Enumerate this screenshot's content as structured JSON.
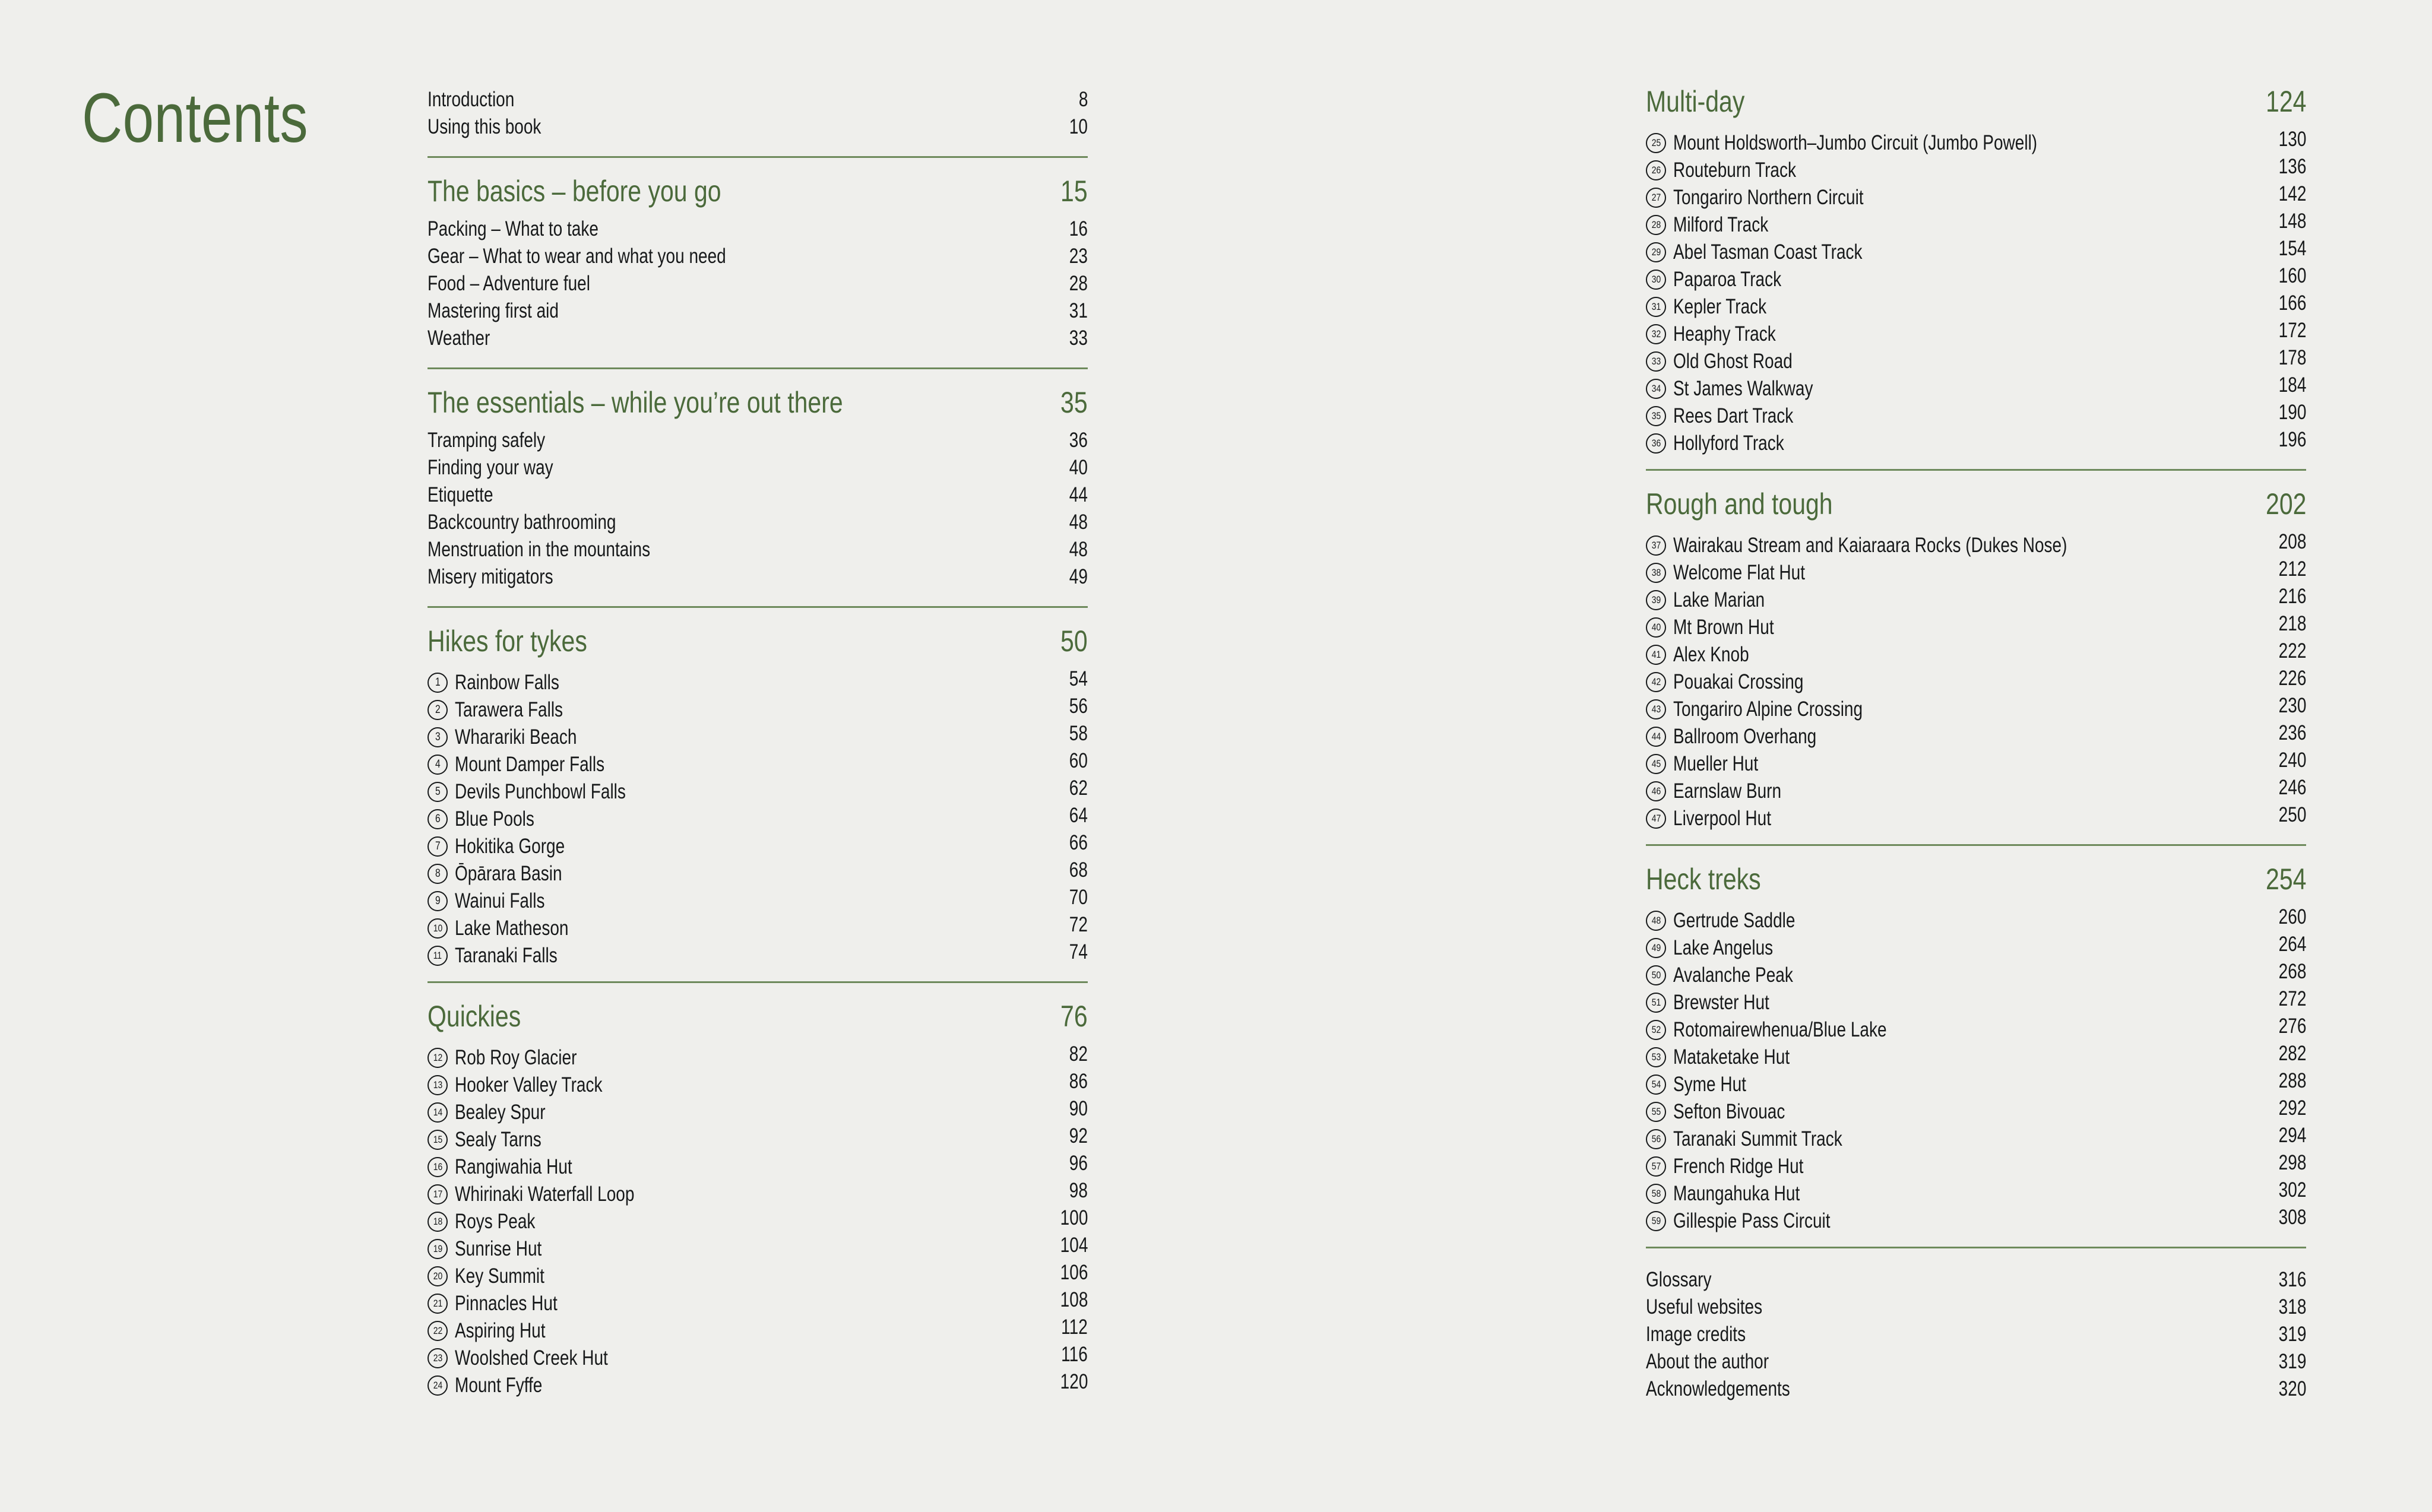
{
  "page_title": "Contents",
  "colors": {
    "background": "#efefec",
    "accent_green": "#4b6a3b",
    "rule_green": "#6e8a5c",
    "text": "#17191a"
  },
  "left_column": [
    {
      "type": "plain_block",
      "entries": [
        {
          "label": "Introduction",
          "page": "8"
        },
        {
          "label": "Using this book",
          "page": "10"
        }
      ]
    },
    {
      "type": "section",
      "heading": {
        "label": "The basics – before you go",
        "page": "15"
      },
      "entries": [
        {
          "label": "Packing – What to take",
          "page": "16"
        },
        {
          "label": "Gear – What to wear and what you need",
          "page": "23"
        },
        {
          "label": "Food – Adventure fuel",
          "page": "28"
        },
        {
          "label": "Mastering first aid",
          "page": "31"
        },
        {
          "label": "Weather",
          "page": "33"
        }
      ]
    },
    {
      "type": "section",
      "heading": {
        "label": "The essentials – while you’re out there",
        "page": "35"
      },
      "entries": [
        {
          "label": "Tramping safely",
          "page": "36"
        },
        {
          "label": "Finding your way",
          "page": "40"
        },
        {
          "label": "Etiquette",
          "page": "44"
        },
        {
          "label": "Backcountry bathrooming",
          "page": "48"
        },
        {
          "label": "Menstruation in the mountains",
          "page": "48"
        },
        {
          "label": "Misery mitigators",
          "page": "49"
        }
      ]
    },
    {
      "type": "section",
      "heading": {
        "label": "Hikes for tykes",
        "page": "50"
      },
      "entries": [
        {
          "num": "1",
          "label": "Rainbow Falls",
          "page": "54"
        },
        {
          "num": "2",
          "label": "Tarawera Falls",
          "page": "56"
        },
        {
          "num": "3",
          "label": "Wharariki Beach",
          "page": "58"
        },
        {
          "num": "4",
          "label": "Mount Damper Falls",
          "page": "60"
        },
        {
          "num": "5",
          "label": "Devils Punchbowl Falls",
          "page": "62"
        },
        {
          "num": "6",
          "label": "Blue Pools",
          "page": "64"
        },
        {
          "num": "7",
          "label": "Hokitika Gorge",
          "page": "66"
        },
        {
          "num": "8",
          "label": "Ōpārara Basin",
          "page": "68"
        },
        {
          "num": "9",
          "label": "Wainui Falls",
          "page": "70"
        },
        {
          "num": "10",
          "label": "Lake Matheson",
          "page": "72"
        },
        {
          "num": "11",
          "label": "Taranaki Falls",
          "page": "74"
        }
      ]
    },
    {
      "type": "section",
      "heading": {
        "label": "Quickies",
        "page": "76"
      },
      "entries": [
        {
          "num": "12",
          "label": "Rob Roy Glacier",
          "page": "82"
        },
        {
          "num": "13",
          "label": "Hooker Valley Track",
          "page": "86"
        },
        {
          "num": "14",
          "label": "Bealey Spur",
          "page": "90"
        },
        {
          "num": "15",
          "label": "Sealy Tarns",
          "page": "92"
        },
        {
          "num": "16",
          "label": "Rangiwahia Hut",
          "page": "96"
        },
        {
          "num": "17",
          "label": "Whirinaki Waterfall Loop",
          "page": "98"
        },
        {
          "num": "18",
          "label": "Roys Peak",
          "page": "100"
        },
        {
          "num": "19",
          "label": "Sunrise Hut",
          "page": "104"
        },
        {
          "num": "20",
          "label": "Key Summit",
          "page": "106"
        },
        {
          "num": "21",
          "label": "Pinnacles Hut",
          "page": "108"
        },
        {
          "num": "22",
          "label": "Aspiring Hut",
          "page": "112"
        },
        {
          "num": "23",
          "label": "Woolshed Creek Hut",
          "page": "116"
        },
        {
          "num": "24",
          "label": "Mount Fyffe",
          "page": "120"
        }
      ]
    }
  ],
  "right_column": [
    {
      "type": "section",
      "heading": {
        "label": "Multi-day",
        "page": "124"
      },
      "entries": [
        {
          "num": "25",
          "label": "Mount Holdsworth–Jumbo Circuit (Jumbo Powell)",
          "page": "130"
        },
        {
          "num": "26",
          "label": "Routeburn Track",
          "page": "136"
        },
        {
          "num": "27",
          "label": "Tongariro Northern Circuit",
          "page": "142"
        },
        {
          "num": "28",
          "label": "Milford Track",
          "page": "148"
        },
        {
          "num": "29",
          "label": "Abel Tasman Coast Track",
          "page": "154"
        },
        {
          "num": "30",
          "label": "Paparoa Track",
          "page": "160"
        },
        {
          "num": "31",
          "label": "Kepler Track",
          "page": "166"
        },
        {
          "num": "32",
          "label": "Heaphy Track",
          "page": "172"
        },
        {
          "num": "33",
          "label": "Old Ghost Road",
          "page": "178"
        },
        {
          "num": "34",
          "label": "St James Walkway",
          "page": "184"
        },
        {
          "num": "35",
          "label": "Rees Dart Track",
          "page": "190"
        },
        {
          "num": "36",
          "label": "Hollyford Track",
          "page": "196"
        }
      ]
    },
    {
      "type": "section",
      "heading": {
        "label": "Rough and tough",
        "page": "202"
      },
      "entries": [
        {
          "num": "37",
          "label": "Wairakau Stream and Kaiaraara Rocks (Dukes Nose)",
          "page": "208"
        },
        {
          "num": "38",
          "label": "Welcome Flat Hut",
          "page": "212"
        },
        {
          "num": "39",
          "label": "Lake Marian",
          "page": "216"
        },
        {
          "num": "40",
          "label": "Mt Brown Hut",
          "page": "218"
        },
        {
          "num": "41",
          "label": "Alex Knob",
          "page": "222"
        },
        {
          "num": "42",
          "label": "Pouakai Crossing",
          "page": "226"
        },
        {
          "num": "43",
          "label": "Tongariro Alpine Crossing",
          "page": "230"
        },
        {
          "num": "44",
          "label": "Ballroom Overhang",
          "page": "236"
        },
        {
          "num": "45",
          "label": "Mueller Hut",
          "page": "240"
        },
        {
          "num": "46",
          "label": "Earnslaw Burn",
          "page": "246"
        },
        {
          "num": "47",
          "label": "Liverpool Hut",
          "page": "250"
        }
      ]
    },
    {
      "type": "section",
      "heading": {
        "label": "Heck treks",
        "page": "254"
      },
      "entries": [
        {
          "num": "48",
          "label": "Gertrude Saddle",
          "page": "260"
        },
        {
          "num": "49",
          "label": "Lake Angelus",
          "page": "264"
        },
        {
          "num": "50",
          "label": "Avalanche Peak",
          "page": "268"
        },
        {
          "num": "51",
          "label": "Brewster Hut",
          "page": "272"
        },
        {
          "num": "52",
          "label": "Rotomairewhenua/Blue Lake",
          "page": "276"
        },
        {
          "num": "53",
          "label": "Mataketake Hut",
          "page": "282"
        },
        {
          "num": "54",
          "label": "Syme Hut",
          "page": "288"
        },
        {
          "num": "55",
          "label": "Sefton Bivouac",
          "page": "292"
        },
        {
          "num": "56",
          "label": "Taranaki Summit Track",
          "page": "294"
        },
        {
          "num": "57",
          "label": "French Ridge Hut",
          "page": "298"
        },
        {
          "num": "58",
          "label": "Maungahuka Hut",
          "page": "302"
        },
        {
          "num": "59",
          "label": "Gillespie Pass Circuit",
          "page": "308"
        }
      ]
    },
    {
      "type": "plain_block",
      "entries": [
        {
          "label": "Glossary",
          "page": "316"
        },
        {
          "label": "Useful websites",
          "page": "318"
        },
        {
          "label": "Image credits",
          "page": "319"
        },
        {
          "label": "About the author",
          "page": "319"
        },
        {
          "label": "Acknowledgements",
          "page": "320"
        }
      ]
    }
  ]
}
